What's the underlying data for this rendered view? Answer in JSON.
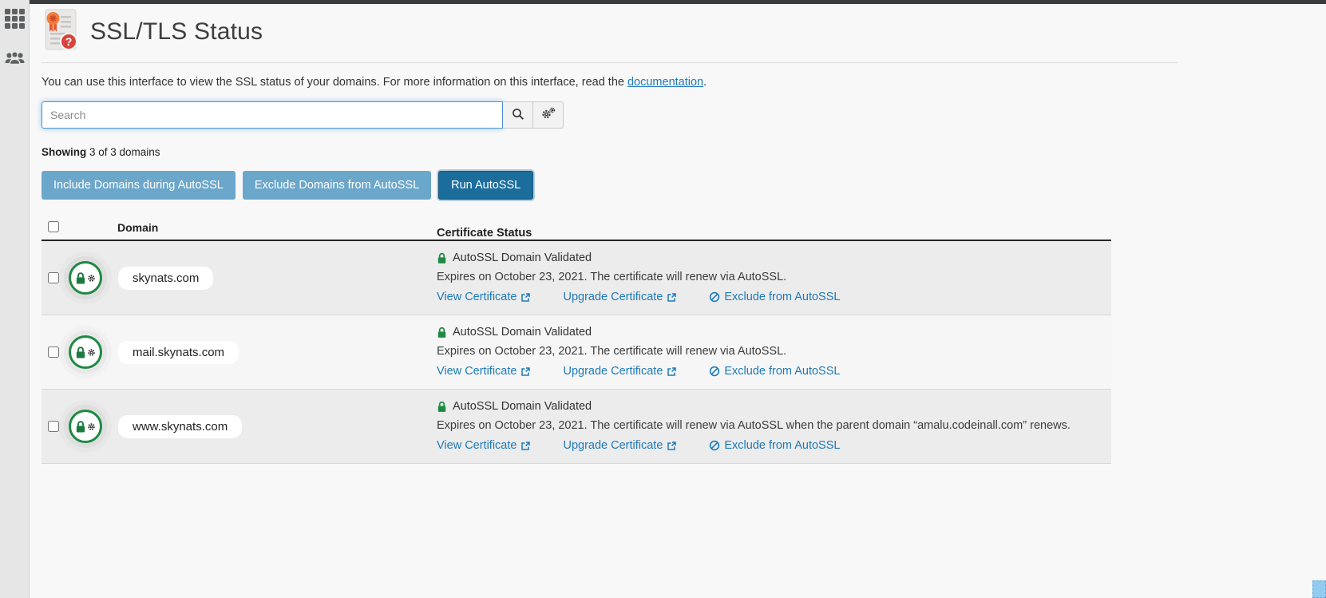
{
  "sidebar": {
    "icons": [
      "apps-grid",
      "user-groups"
    ]
  },
  "header": {
    "title": "SSL/TLS Status"
  },
  "intro": {
    "before": "You can use this interface to view the SSL status of your domains. For more information on this interface, read the ",
    "link": "documentation",
    "after": "."
  },
  "search": {
    "placeholder": "Search"
  },
  "summary": {
    "label": "Showing",
    "detail": " 3 of 3 domains"
  },
  "actions": {
    "include_label": "Include Domains during AutoSSL",
    "exclude_label": "Exclude Domains from AutoSSL",
    "run_label": "Run AutoSSL"
  },
  "table": {
    "domain_header": "Domain",
    "status_header": "Certificate Status",
    "rows": [
      {
        "domain": "skynats.com",
        "status": "AutoSSL Domain Validated",
        "expires": "Expires on October 23, 2021. The certificate will renew via AutoSSL.",
        "view_link": "View Certificate",
        "upgrade_link": "Upgrade Certificate",
        "exclude_link": "Exclude from AutoSSL"
      },
      {
        "domain": "mail.skynats.com",
        "status": "AutoSSL Domain Validated",
        "expires": "Expires on October 23, 2021. The certificate will renew via AutoSSL.",
        "view_link": "View Certificate",
        "upgrade_link": "Upgrade Certificate",
        "exclude_link": "Exclude from AutoSSL"
      },
      {
        "domain": "www.skynats.com",
        "status": "AutoSSL Domain Validated",
        "expires": "Expires on October 23, 2021. The certificate will renew via AutoSSL when the parent domain “amalu.codeinall.com” renews.",
        "view_link": "View Certificate",
        "upgrade_link": "Upgrade Certificate",
        "exclude_link": "Exclude from AutoSSL"
      }
    ]
  },
  "colors": {
    "link_blue": "#1d7ab8",
    "button_light": "#6ba7cb",
    "button_dark": "#1b6d9c",
    "status_green": "#1f8a44",
    "topbar": "#383c3e"
  }
}
